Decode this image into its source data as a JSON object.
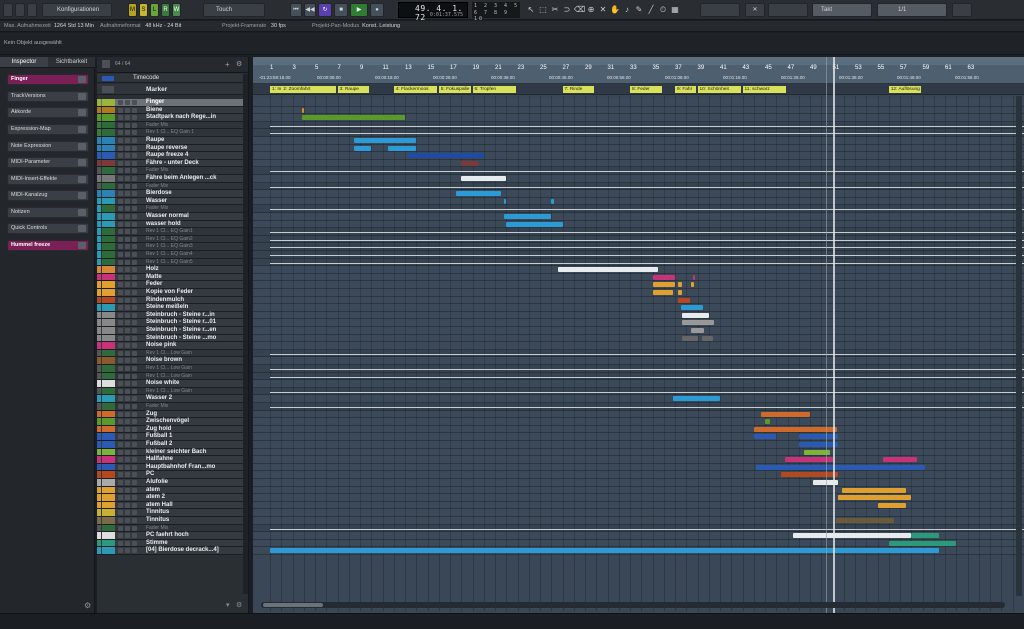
{
  "toolbar": {
    "config_label": "Konfigurationen",
    "msr": [
      "M",
      "S",
      "L",
      "R",
      "W"
    ],
    "automation_mode": "Touch",
    "time_main": "49. 4. 1. 72",
    "time_sub": "0:01:37.575",
    "numpad_row1": "1 2 3 4 5",
    "numpad_row2": "6 7 8 9 10",
    "grid_type": "Takt",
    "quantize": "1/1"
  },
  "status": {
    "max_rec_label": "Max. Aufnahmezeit",
    "max_rec_value": "1264 Std 13 Min",
    "rec_format_label": "Aufnahmeformat",
    "rec_format_value": "48 kHz - 24 Bit",
    "framerate_label": "Projekt-Framerate",
    "framerate_value": "30 fps",
    "pan_label": "Projekt-Pan-Modus",
    "pan_value": "Konst. Leistung"
  },
  "infoline": "Kein Objekt ausgewählt",
  "inspector": {
    "tabs": [
      "Inspector",
      "Sichtbarkeit"
    ],
    "track_name": "Finger",
    "sections": [
      "TrackVersions",
      "Akkorde",
      "Expression-Map",
      "Note Expression",
      "MIDI-Parameter",
      "MIDI-Insert-Effekte",
      "MIDI-Kanalzug",
      "Notizen",
      "Quick Controls"
    ],
    "bottom_track": "Hummel freeze"
  },
  "tracklist": {
    "count": "64 / 64",
    "header_timecode": "Timecode",
    "header_marker": "Marker",
    "tracks": [
      {
        "name": "Finger",
        "color": "#9ab53a",
        "sel": true
      },
      {
        "name": "Biene",
        "color": "#b07a1f"
      },
      {
        "name": "Stadtpark nach Rege...in",
        "color": "#5a9a2a"
      },
      {
        "name": "Fader Mix",
        "color": "#3a7a3a",
        "sub": true
      },
      {
        "name": "Rev 1 Cl... EQ Gain 1",
        "color": "#3a7a3a",
        "sub": true
      },
      {
        "name": "Raupe",
        "color": "#2b82b5"
      },
      {
        "name": "Raupe reverse",
        "color": "#2b82b5"
      },
      {
        "name": "Raupe freeze 4",
        "color": "#2b5ab5"
      },
      {
        "name": "Fähre - unter Deck",
        "color": "#7a3a3a"
      },
      {
        "name": "Fader Mix",
        "color": "#555",
        "sub": true
      },
      {
        "name": "Fähre beim Anlegen ...ck",
        "color": "#777"
      },
      {
        "name": "Fader Mix",
        "color": "#555",
        "sub": true
      },
      {
        "name": "Bierdose",
        "color": "#2b82b5"
      },
      {
        "name": "Wasser",
        "color": "#2b9ab5"
      },
      {
        "name": "Fader Mix",
        "color": "#2b9ab5",
        "sub": true
      },
      {
        "name": "Wasser normal",
        "color": "#2b9ab5"
      },
      {
        "name": "wasser hold",
        "color": "#2b9ab5"
      },
      {
        "name": "Rev 1 Cl... EQ Gain1",
        "color": "#2b9ab5",
        "sub": true
      },
      {
        "name": "Rev 1 Cl... EQ Gain2",
        "color": "#2b9ab5",
        "sub": true
      },
      {
        "name": "Rev 1 Cl... EQ Gain3",
        "color": "#2b9ab5",
        "sub": true
      },
      {
        "name": "Rev 1 Cl... EQ Gain4",
        "color": "#2b9ab5",
        "sub": true
      },
      {
        "name": "Rev 1 Cl... EQ Gain5",
        "color": "#2b9ab5",
        "sub": true
      },
      {
        "name": "Holz",
        "color": "#d8863a"
      },
      {
        "name": "Matte",
        "color": "#c8327a"
      },
      {
        "name": "Feder",
        "color": "#e0a030"
      },
      {
        "name": "Kopie von Feder",
        "color": "#e0a030"
      },
      {
        "name": "Rindenmulch",
        "color": "#b5481f"
      },
      {
        "name": "Steine meißeln",
        "color": "#2b9ab5"
      },
      {
        "name": "Steinbruch - Steine r...in",
        "color": "#888"
      },
      {
        "name": "Steinbruch - Steine r...01",
        "color": "#888"
      },
      {
        "name": "Steinbruch - Steine r...en",
        "color": "#888"
      },
      {
        "name": "Steinbruch - Steine ...mo",
        "color": "#888"
      },
      {
        "name": "Noise pink",
        "color": "#c8327a"
      },
      {
        "name": "Rev 1 Cl... Low Gain",
        "color": "#555",
        "sub": true
      },
      {
        "name": "Noise brown",
        "color": "#8a5a2a"
      },
      {
        "name": "Rev 1 Cl... Low Gain",
        "color": "#555",
        "sub": true
      },
      {
        "name": "Rev 1 Cl... Low Gain",
        "color": "#555",
        "sub": true
      },
      {
        "name": "Noise white",
        "color": "#ddd"
      },
      {
        "name": "Rev 1 Cl... Low Gain",
        "color": "#555",
        "sub": true
      },
      {
        "name": "Wasser 2",
        "color": "#2b9ab5"
      },
      {
        "name": "Fader Mix",
        "color": "#555",
        "sub": true
      },
      {
        "name": "Zug",
        "color": "#d06a2a"
      },
      {
        "name": "Zwischenvögel",
        "color": "#5a9a2a"
      },
      {
        "name": "Zug hold",
        "color": "#d06a2a"
      },
      {
        "name": "Fußball 1",
        "color": "#2b5ab5"
      },
      {
        "name": "Fußball 2",
        "color": "#2b5ab5"
      },
      {
        "name": "kleiner seichter Bach",
        "color": "#7ab53a"
      },
      {
        "name": "Hallfahne",
        "color": "#c8327a"
      },
      {
        "name": "Hauptbahnhof Fran...mo",
        "color": "#2b5ab5"
      },
      {
        "name": "PC",
        "color": "#b5481f"
      },
      {
        "name": "Alufolie",
        "color": "#aaa"
      },
      {
        "name": "atem",
        "color": "#e0a030"
      },
      {
        "name": "atem 2",
        "color": "#e0a030"
      },
      {
        "name": "atem Hall",
        "color": "#e0a030"
      },
      {
        "name": "Tinnitus",
        "color": "#c8b030"
      },
      {
        "name": "Tinnitus",
        "color": "#7a6a4a"
      },
      {
        "name": "Fader Mix",
        "color": "#555",
        "sub": true
      },
      {
        "name": "PC faehrt hoch",
        "color": "#ddd"
      },
      {
        "name": "Stimme",
        "color": "#2b9a7a"
      },
      {
        "name": "[04] Bierdose decrack...4]",
        "color": "#2b9ab5"
      }
    ]
  },
  "ruler": {
    "bars": [
      "1",
      "3",
      "5",
      "7",
      "9",
      "11",
      "13",
      "15",
      "17",
      "19",
      "21",
      "23",
      "25",
      "27",
      "29",
      "31",
      "33",
      "35",
      "37",
      "39",
      "41",
      "43",
      "45",
      "47",
      "49",
      "51",
      "53",
      "55",
      "57",
      "59",
      "61",
      "63"
    ],
    "times": [
      "-01:23:59:18.00",
      "00:00:08.00",
      "00:00:18.00",
      "00:00:28.00",
      "00:00:38.00",
      "00:00:48.00",
      "00:00:58.00",
      "00:01:08.00",
      "00:01:18.00",
      "00:01:28.00",
      "00:01:38.00",
      "00:01:48.00",
      "00:01:58.00"
    ]
  },
  "markers": [
    {
      "label": "1: Intro",
      "bar": 1,
      "end": 2
    },
    {
      "label": "2: Zoomfahrt",
      "bar": 2,
      "end": 7
    },
    {
      "label": "3: Raupe",
      "bar": 7,
      "end": 10
    },
    {
      "label": "4: Flackermoos",
      "bar": 12,
      "end": 16
    },
    {
      "label": "5: Fokuspalle",
      "bar": 16,
      "end": 19
    },
    {
      "label": "6: Tropfen",
      "bar": 19,
      "end": 23
    },
    {
      "label": "7: Rinde",
      "bar": 27,
      "end": 30
    },
    {
      "label": "8: Feder",
      "bar": 33,
      "end": 36
    },
    {
      "label": "9: Fahr",
      "bar": 37,
      "end": 39
    },
    {
      "label": "10: Schönheit",
      "bar": 39,
      "end": 43
    },
    {
      "label": "11: schwarz",
      "bar": 43,
      "end": 47
    },
    {
      "label": "12: Auflösung",
      "bar": 56,
      "end": 59
    }
  ],
  "colors": {
    "arrange_bg": "#3a4756",
    "accent": "#7b1f57",
    "marker": "#d9e05a"
  }
}
